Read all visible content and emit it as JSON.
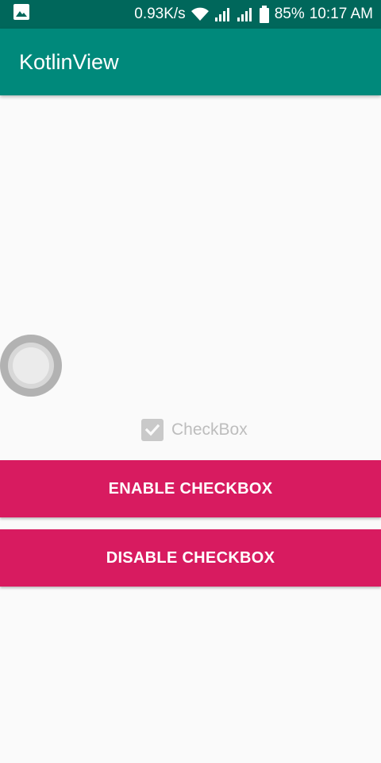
{
  "status_bar": {
    "network_speed": "0.93K/s",
    "battery": "85%",
    "time": "10:17 AM",
    "icons": [
      "image-notification-icon",
      "wifi-icon",
      "signal-icon",
      "signal-icon",
      "battery-icon"
    ]
  },
  "app_bar": {
    "title": "KotlinView"
  },
  "checkbox": {
    "label": "CheckBox",
    "checked": true,
    "enabled": false
  },
  "buttons": {
    "enable_label": "ENABLE CHECKBOX",
    "disable_label": "DISABLE CHECKBOX"
  },
  "colors": {
    "status_bar": "#00675b",
    "app_bar": "#00897b",
    "button": "#d81b60",
    "background": "#fafafa"
  }
}
